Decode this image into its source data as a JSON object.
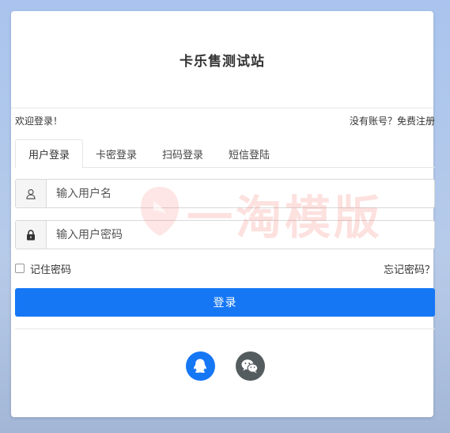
{
  "site": {
    "title": "卡乐售测试站"
  },
  "welcome": {
    "text": "欢迎登录！",
    "register_prompt": "没有账号？",
    "register_link": "免费注册"
  },
  "tabs": [
    {
      "label": "用户登录",
      "active": true
    },
    {
      "label": "卡密登录",
      "active": false
    },
    {
      "label": "扫码登录",
      "active": false
    },
    {
      "label": "短信登陆",
      "active": false
    }
  ],
  "form": {
    "username_placeholder": "输入用户名",
    "username_value": "",
    "password_placeholder": "输入用户密码",
    "password_value": "",
    "remember_label": "记住密码",
    "remember_checked": false,
    "forgot_label": "忘记密码？",
    "login_label": "登录"
  },
  "social": [
    {
      "name": "qq",
      "icon": "qq-icon",
      "color": "#1677f5"
    },
    {
      "name": "wechat",
      "icon": "wechat-icon",
      "color": "#555c5f"
    }
  ],
  "watermark": {
    "text": "一淘模版"
  },
  "colors": {
    "primary": "#1677f5",
    "background": "#a9c4ee"
  }
}
